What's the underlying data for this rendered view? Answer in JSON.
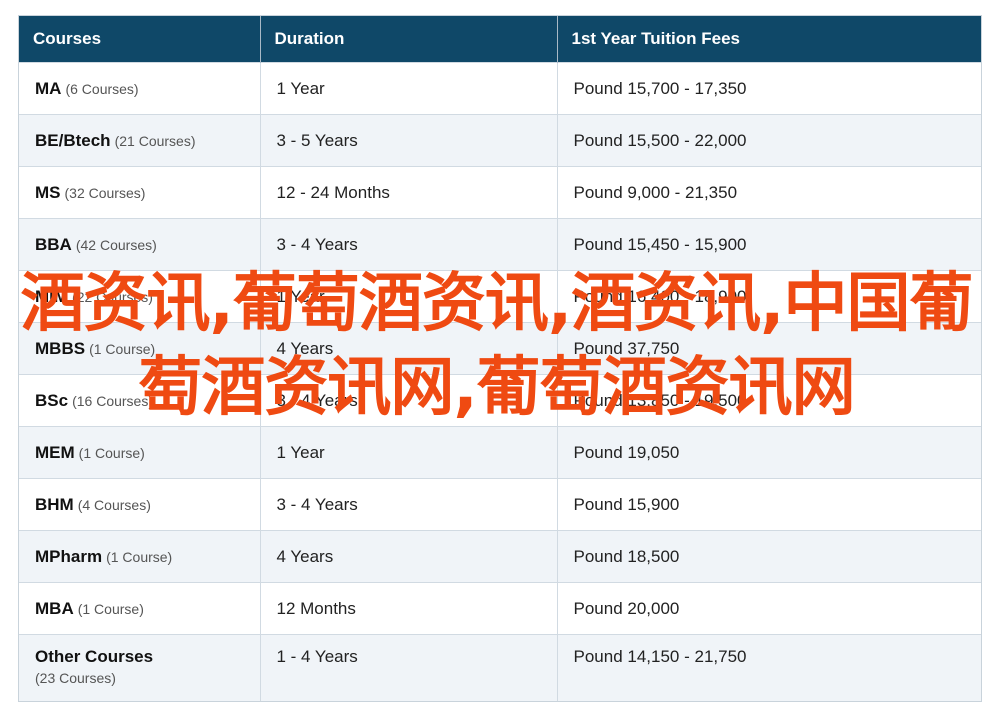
{
  "table": {
    "headers": [
      "Courses",
      "Duration",
      "1st Year Tuition Fees"
    ],
    "rows": [
      {
        "name": "MA",
        "count": "(6 Courses)",
        "duration": "1 Year",
        "fees": "Pound 15,700 - 17,350"
      },
      {
        "name": "BE/Btech",
        "count": "(21 Courses)",
        "duration": "3 - 5 Years",
        "fees": "Pound 15,500 - 22,000"
      },
      {
        "name": "MS",
        "count": "(32 Courses)",
        "duration": "12 - 24 Months",
        "fees": "Pound 9,000 - 21,350"
      },
      {
        "name": "BBA",
        "count": "(42 Courses)",
        "duration": "3 - 4 Years",
        "fees": "Pound 15,450 - 15,900"
      },
      {
        "name": "MIM",
        "count": "(22 Courses)",
        "duration": "1 Year",
        "fees": "Pound 16,400 - 18,900"
      },
      {
        "name": "MBBS",
        "count": "(1 Course)",
        "duration": "4 Years",
        "fees": "Pound 37,750"
      },
      {
        "name": "BSc",
        "count": "(16 Courses)",
        "duration": "3 - 4 Years",
        "fees": "Pound 13,850 - 19,500"
      },
      {
        "name": "MEM",
        "count": "(1 Course)",
        "duration": "1 Year",
        "fees": "Pound 19,050"
      },
      {
        "name": "BHM",
        "count": "(4 Courses)",
        "duration": "3 - 4 Years",
        "fees": "Pound 15,900"
      },
      {
        "name": "MPharm",
        "count": "(1 Course)",
        "duration": "4 Years",
        "fees": "Pound 18,500"
      },
      {
        "name": "MBA",
        "count": "(1 Course)",
        "duration": "12 Months",
        "fees": "Pound 20,000"
      },
      {
        "name": "Other Courses",
        "count": "(23 Courses)",
        "duration": "1 - 4 Years",
        "fees": "Pound 14,150 - 21,750"
      }
    ]
  },
  "overlay": {
    "text": "酒资讯,葡萄酒资讯,酒资讯,中国葡萄酒资讯网,葡萄酒资讯网",
    "color": "#ef4a12"
  }
}
